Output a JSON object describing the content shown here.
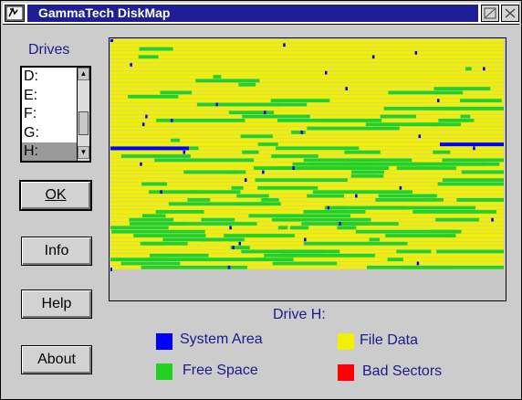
{
  "window": {
    "title": "GammaTech DiskMap"
  },
  "drives": {
    "label": "Drives",
    "items": [
      "D:",
      "E:",
      "F:",
      "G:",
      "H:"
    ],
    "selected": "H:"
  },
  "buttons": {
    "ok": "OK",
    "info": "Info",
    "help": "Help",
    "about": "About"
  },
  "map": {
    "drive_label": "Drive H:",
    "colors": {
      "system": "#0000ff",
      "free": "#22d222",
      "file": "#f0f000",
      "bad": "#ff0000"
    }
  },
  "legend": {
    "system": "System Area",
    "file": "File Data",
    "free": "Free Space",
    "bad": "Bad Sectors"
  }
}
